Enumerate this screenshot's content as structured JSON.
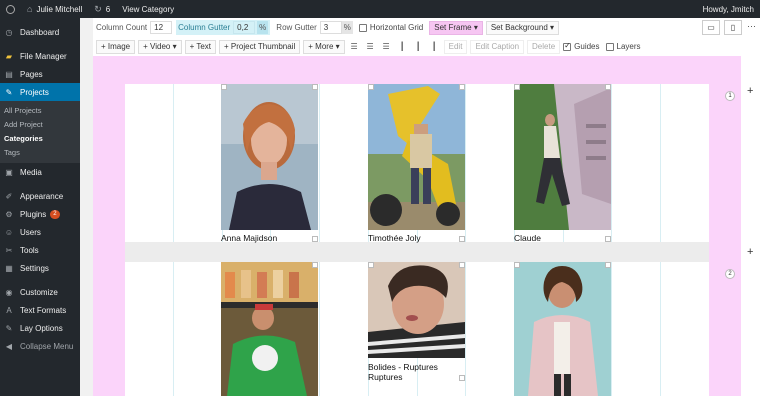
{
  "adminbar": {
    "site_name": "Julie Mitchell",
    "updates_count": "6",
    "view_link": "View Category",
    "greeting": "Howdy, Jmitch"
  },
  "sidebar": {
    "items": [
      {
        "icon": "dashboard-icon",
        "glyph": "◷",
        "label": "Dashboard"
      },
      {
        "icon": "folder-icon",
        "glyph": "▰",
        "label": "File Manager"
      },
      {
        "icon": "pages-icon",
        "glyph": "▤",
        "label": "Pages"
      },
      {
        "icon": "pin-icon",
        "glyph": "✎",
        "label": "Projects"
      }
    ],
    "submenu": [
      "All Projects",
      "Add Project",
      "Categories",
      "Tags"
    ],
    "items2": [
      {
        "icon": "media-icon",
        "glyph": "▣",
        "label": "Media"
      },
      {
        "icon": "appearance-icon",
        "glyph": "✐",
        "label": "Appearance"
      },
      {
        "icon": "plugins-icon",
        "glyph": "⚙",
        "label": "Plugins",
        "badge": "2"
      },
      {
        "icon": "users-icon",
        "glyph": "☺",
        "label": "Users"
      },
      {
        "icon": "tools-icon",
        "glyph": "✂",
        "label": "Tools"
      },
      {
        "icon": "settings-icon",
        "glyph": "▦",
        "label": "Settings"
      }
    ],
    "items3": [
      {
        "icon": "customize-icon",
        "glyph": "◉",
        "label": "Customize"
      },
      {
        "icon": "text-formats-icon",
        "glyph": "A",
        "label": "Text Formats"
      },
      {
        "icon": "lay-options-icon",
        "glyph": "✎",
        "label": "Lay Options"
      },
      {
        "icon": "collapse-icon",
        "glyph": "◀",
        "label": "Collapse Menu"
      }
    ]
  },
  "toolbar": {
    "column_count_label": "Column Count",
    "column_count_value": "12",
    "column_gutter_label": "Column Gutter",
    "column_gutter_value": "0,2",
    "column_gutter_unit": "%",
    "row_gutter_label": "Row Gutter",
    "row_gutter_value": "3",
    "row_gutter_unit": "%",
    "horizontal_grid_label": "Horizontal Grid",
    "set_frame_label": "Set Frame",
    "set_background_label": "Set Background",
    "add_image": "+ Image",
    "add_video": "+ Video",
    "add_text": "+ Text",
    "add_thumbnail": "+ Project Thumbnail",
    "add_more": "+ More",
    "edit": "Edit",
    "edit_caption": "Edit Caption",
    "delete": "Delete",
    "guides_label": "Guides",
    "layers_label": "Layers"
  },
  "rows": [
    {
      "number": "1"
    },
    {
      "number": "2"
    }
  ],
  "captions": [
    "Anna Majidson",
    "Timothée Joly",
    "Claude",
    "Bolides - Ruptures",
    "Ruptures"
  ],
  "colors": {
    "admin_dark": "#23282d",
    "admin_accent": "#0073aa",
    "canvas_pink": "#fbd4fa",
    "gutter_highlight": "#d4f1f7"
  }
}
